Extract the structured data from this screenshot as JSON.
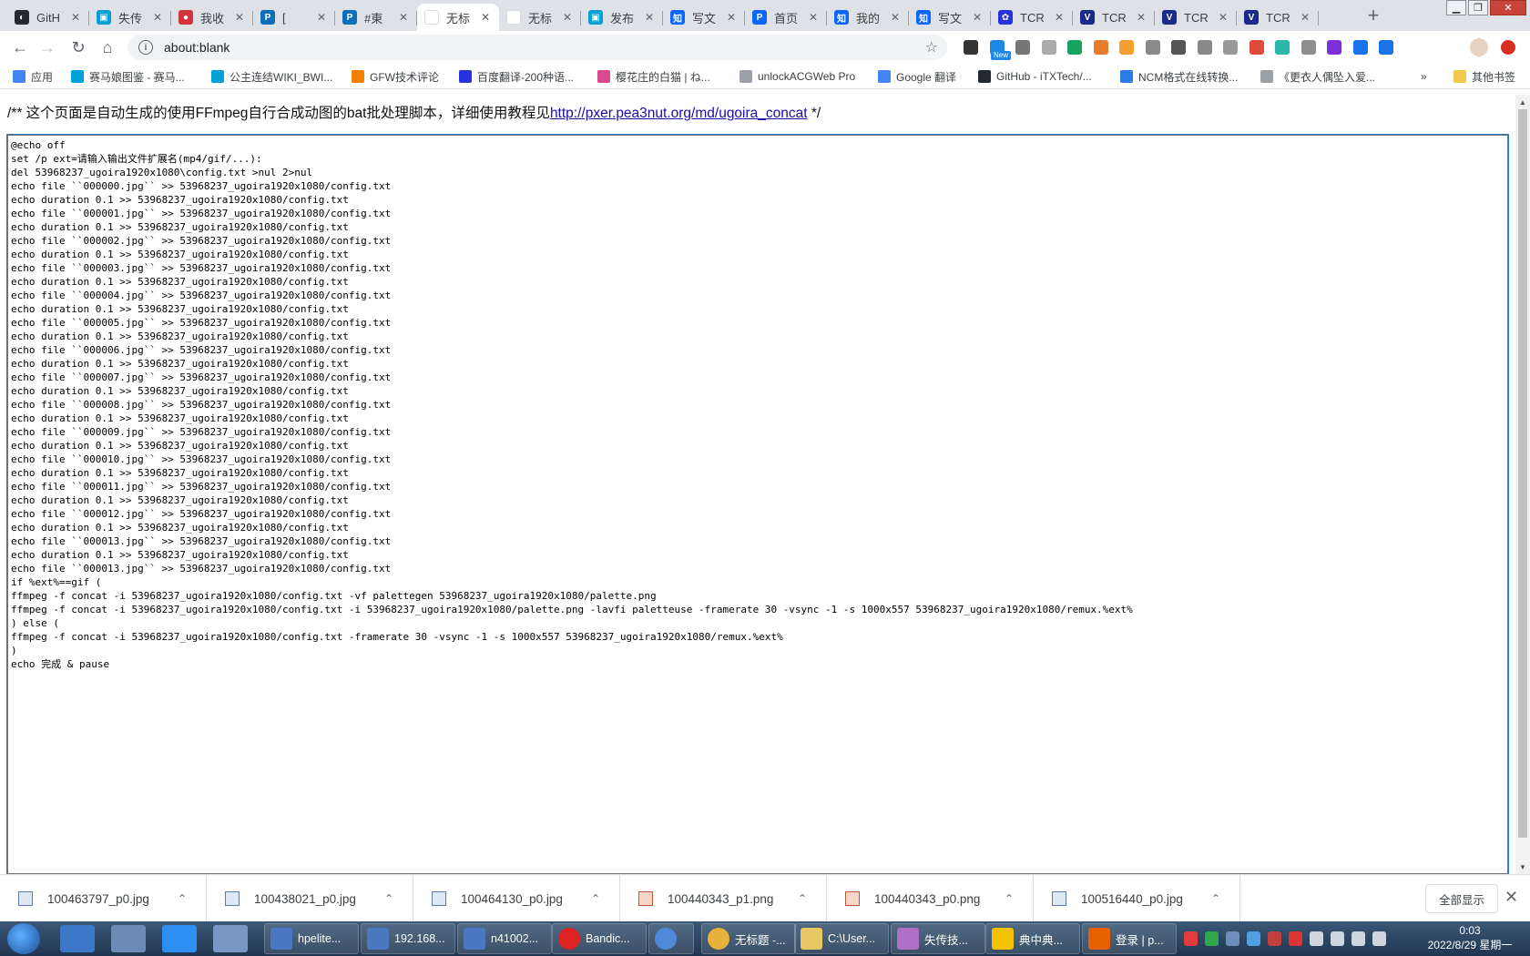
{
  "browser": {
    "tabs": [
      {
        "title": "GitH",
        "icon": "github-icon",
        "color": "#24292e",
        "glyph": "◐"
      },
      {
        "title": "失传",
        "icon": "bilibili-icon",
        "color": "#00a1d6",
        "glyph": "▣"
      },
      {
        "title": "我收",
        "icon": "weibo-icon",
        "color": "#d0353b",
        "glyph": "●"
      },
      {
        "title": "[",
        "icon": "pixiv-icon",
        "color": "#0d6fb8",
        "glyph": "P"
      },
      {
        "title": "#東",
        "icon": "pixiv-icon",
        "color": "#0d6fb8",
        "glyph": "P"
      },
      {
        "title": "无标",
        "icon": "blank-page-icon",
        "color": "#ffffff",
        "glyph": ""
      },
      {
        "title": "无标",
        "icon": "blank-page-icon",
        "color": "#ffffff",
        "glyph": ""
      },
      {
        "title": "发布",
        "icon": "bilibili-icon",
        "color": "#00a1d6",
        "glyph": "▣"
      },
      {
        "title": "写文",
        "icon": "zhihu-icon",
        "color": "#0a66ff",
        "glyph": "知"
      },
      {
        "title": "首页",
        "icon": "pxer-icon",
        "color": "#0a66ff",
        "glyph": "P"
      },
      {
        "title": "我的",
        "icon": "zhihu-icon",
        "color": "#0a66ff",
        "glyph": "知"
      },
      {
        "title": "写文",
        "icon": "zhihu-icon",
        "color": "#0a66ff",
        "glyph": "知"
      },
      {
        "title": "TCR",
        "icon": "baidu-icon",
        "color": "#2932e1",
        "glyph": "✿"
      },
      {
        "title": "TCR",
        "icon": "tcr-icon",
        "color": "#1a2a8a",
        "glyph": "V"
      },
      {
        "title": "TCR",
        "icon": "tcr-icon",
        "color": "#1a2a8a",
        "glyph": "V"
      },
      {
        "title": "TCR",
        "icon": "tcr-icon",
        "color": "#1a2a8a",
        "glyph": "V"
      }
    ],
    "active_tab": 5,
    "tab_close_glyph": "✕",
    "new_tab_glyph": "+",
    "address": "about:blank",
    "star_glyph": "☆",
    "back_glyph": "←",
    "forward_glyph": "→",
    "reload_glyph": "↻",
    "home_glyph": "⌂",
    "info_glyph": "i",
    "extension_badge": "New",
    "bookmarks": [
      {
        "label": "应用",
        "icon": "apps-icon",
        "color": "#4285f4"
      },
      {
        "label": "赛马娘图鉴 - 赛马...",
        "icon": "bilibili-icon",
        "color": "#00a1d6"
      },
      {
        "label": "公主连结WIKI_BWI...",
        "icon": "bilibili-icon",
        "color": "#00a1d6"
      },
      {
        "label": "GFW技术评论",
        "icon": "blogger-icon",
        "color": "#f57d00"
      },
      {
        "label": "百度翻译-200种语...",
        "icon": "baidu-translate-icon",
        "color": "#2932e1"
      },
      {
        "label": "樱花庄的白猫 | ね...",
        "icon": "sakura-icon",
        "color": "#d94a8c"
      },
      {
        "label": "unlockACGWeb Pro",
        "icon": "page-icon",
        "color": "#9aa0a6"
      },
      {
        "label": "Google 翻译",
        "icon": "google-translate-icon",
        "color": "#4285f4"
      },
      {
        "label": "GitHub - iTXTech/...",
        "icon": "github-icon",
        "color": "#24292e"
      },
      {
        "label": "NCM格式在线转换...",
        "icon": "music-icon",
        "color": "#2b7de9"
      },
      {
        "label": "《更衣人偶坠入爱...",
        "icon": "page-icon",
        "color": "#9aa0a6"
      }
    ],
    "bookmarks_more": "»",
    "other_bookmarks": "其他书签"
  },
  "page": {
    "header_prefix": "/** 这个页面是自动生成的使用FFmpeg自行合成动图的bat批处理脚本，详细使用教程见",
    "header_link": "http://pxer.pea3nut.org/md/ugoira_concat",
    "header_suffix": " */",
    "script_lines": [
      "@echo off",
      "set /p ext=请输入输出文件扩展名(mp4/gif/...):",
      "del 53968237_ugoira1920x1080\\config.txt >nul 2>nul",
      "echo file ``000000.jpg`` >> 53968237_ugoira1920x1080/config.txt",
      "echo duration 0.1 >> 53968237_ugoira1920x1080/config.txt",
      "echo file ``000001.jpg`` >> 53968237_ugoira1920x1080/config.txt",
      "echo duration 0.1 >> 53968237_ugoira1920x1080/config.txt",
      "echo file ``000002.jpg`` >> 53968237_ugoira1920x1080/config.txt",
      "echo duration 0.1 >> 53968237_ugoira1920x1080/config.txt",
      "echo file ``000003.jpg`` >> 53968237_ugoira1920x1080/config.txt",
      "echo duration 0.1 >> 53968237_ugoira1920x1080/config.txt",
      "echo file ``000004.jpg`` >> 53968237_ugoira1920x1080/config.txt",
      "echo duration 0.1 >> 53968237_ugoira1920x1080/config.txt",
      "echo file ``000005.jpg`` >> 53968237_ugoira1920x1080/config.txt",
      "echo duration 0.1 >> 53968237_ugoira1920x1080/config.txt",
      "echo file ``000006.jpg`` >> 53968237_ugoira1920x1080/config.txt",
      "echo duration 0.1 >> 53968237_ugoira1920x1080/config.txt",
      "echo file ``000007.jpg`` >> 53968237_ugoira1920x1080/config.txt",
      "echo duration 0.1 >> 53968237_ugoira1920x1080/config.txt",
      "echo file ``000008.jpg`` >> 53968237_ugoira1920x1080/config.txt",
      "echo duration 0.1 >> 53968237_ugoira1920x1080/config.txt",
      "echo file ``000009.jpg`` >> 53968237_ugoira1920x1080/config.txt",
      "echo duration 0.1 >> 53968237_ugoira1920x1080/config.txt",
      "echo file ``000010.jpg`` >> 53968237_ugoira1920x1080/config.txt",
      "echo duration 0.1 >> 53968237_ugoira1920x1080/config.txt",
      "echo file ``000011.jpg`` >> 53968237_ugoira1920x1080/config.txt",
      "echo duration 0.1 >> 53968237_ugoira1920x1080/config.txt",
      "echo file ``000012.jpg`` >> 53968237_ugoira1920x1080/config.txt",
      "echo duration 0.1 >> 53968237_ugoira1920x1080/config.txt",
      "echo file ``000013.jpg`` >> 53968237_ugoira1920x1080/config.txt",
      "echo duration 0.1 >> 53968237_ugoira1920x1080/config.txt",
      "echo file ``000013.jpg`` >> 53968237_ugoira1920x1080/config.txt",
      "if %ext%==gif (",
      "ffmpeg -f concat -i 53968237_ugoira1920x1080/config.txt -vf palettegen 53968237_ugoira1920x1080/palette.png",
      "ffmpeg -f concat -i 53968237_ugoira1920x1080/config.txt -i 53968237_ugoira1920x1080/palette.png -lavfi paletteuse -framerate 30 -vsync -1 -s 1000x557 53968237_ugoira1920x1080/remux.%ext%",
      ") else (",
      "ffmpeg -f concat -i 53968237_ugoira1920x1080/config.txt -framerate 30 -vsync -1 -s 1000x557 53968237_ugoira1920x1080/remux.%ext%",
      ")",
      "echo 完成 & pause"
    ]
  },
  "downloads": {
    "items": [
      {
        "filename": "100463797_p0.jpg",
        "type": "jpg"
      },
      {
        "filename": "100438021_p0.jpg",
        "type": "jpg"
      },
      {
        "filename": "100464130_p0.jpg",
        "type": "jpg"
      },
      {
        "filename": "100440343_p1.png",
        "type": "png"
      },
      {
        "filename": "100440343_p0.png",
        "type": "png"
      },
      {
        "filename": "100516440_p0.jpg",
        "type": "jpg"
      }
    ],
    "caret_glyph": "⌃",
    "show_all": "全部显示",
    "close_glyph": "✕"
  },
  "taskbar": {
    "tasks": [
      {
        "label": "hpelite...",
        "icon": "remote-desktop-icon",
        "color": "#4a78c0"
      },
      {
        "label": "192.168...",
        "icon": "remote-desktop-icon",
        "color": "#4a78c0"
      },
      {
        "label": "n41002...",
        "icon": "remote-desktop-icon",
        "color": "#4a78c0"
      },
      {
        "label": "Bandic...",
        "icon": "bandicam-icon",
        "color": "#d22"
      },
      {
        "label": "",
        "icon": "chrome-blue-icon",
        "color": "#4f8ad8"
      },
      {
        "label": "无标题 -...",
        "icon": "chrome-icon",
        "color": "#e8b23a"
      },
      {
        "label": "C:\\User...",
        "icon": "folder-icon",
        "color": "#e8c765"
      },
      {
        "label": "失传技...",
        "icon": "image-viewer-icon",
        "color": "#b070c8"
      },
      {
        "label": "典中典...",
        "icon": "potplayer-icon",
        "color": "#f2c200"
      },
      {
        "label": "登录 | p...",
        "icon": "firefox-icon",
        "color": "#e66000"
      }
    ],
    "clock_time": "0:03",
    "clock_date": "2022/8/29 星期一"
  }
}
